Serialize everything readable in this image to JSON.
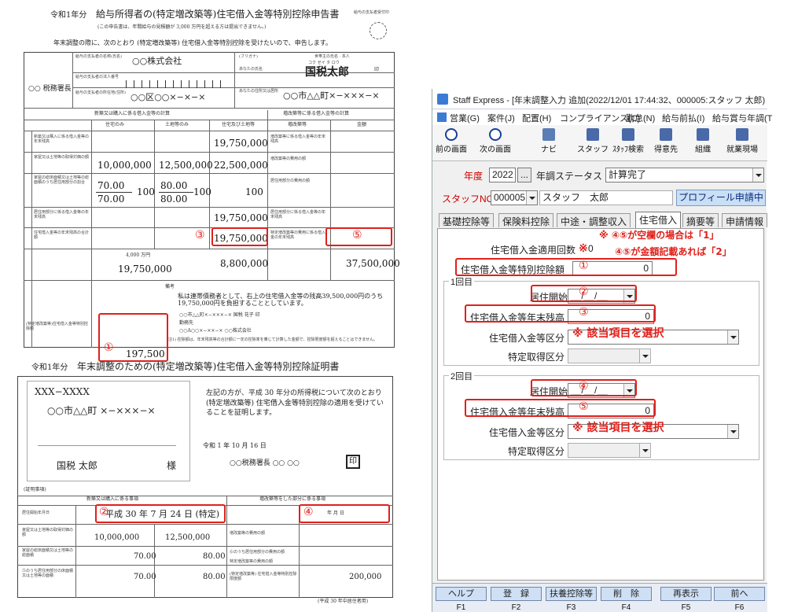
{
  "doc": {
    "form1": {
      "title_year": "令和1年分",
      "title": "給与所得者の(特定増改築等)住宅借入金等特別控除申告書",
      "note_top": "(この申告書は、年間給与の見積額が 3,000 万円を超える方は提出できません。)",
      "submit_line": "年末調整の際に、次のとおり (特定増改築等) 住宅借入金等特別控除を受けたいので、申告します。",
      "corner_text": "給与の支払者受付印",
      "payer_name_label": "給与の支払者の名称(氏名)",
      "payer_name": "○○株式会社",
      "payer_no_label": "給与の支払者の法人番号",
      "payer_addr_label": "給与の支払者の所在地(住所)",
      "payer_addr": "○○区○○×−×−×",
      "office": "○○ 税務署長",
      "furigana_label": "(フリガナ)",
      "furigana": "コク ゼイ タ ロウ",
      "name_label": "あなたの氏名",
      "name": "国税太郎",
      "seal": "印",
      "self_label": "世帯主の氏名 · 本人",
      "addr_label": "あなたの住所又は居所",
      "addr": "○○市△△町×−×××−×",
      "col_house_only": "住宅のみ",
      "col_land_only": "土地等のみ",
      "col_both": "住宅及び土地等",
      "col_renov": "増改築等",
      "col_amount": "金額",
      "section_new": "新築又は購入に係る借入金等の計算",
      "section_renov": "増改築等に係る借入金等の計算",
      "row1": "新築又は購入に係る借入金等の年末残高",
      "row2": "家屋又は土地等の取得対価の額",
      "row3": "家屋の総床面積又は土地等の総面積のうち居住用部分の割合",
      "row4": "居住用部分に係る借入金等の年末残高",
      "row5": "住宅借入金等の年末残高の合計額",
      "row6": "(特定増改築等)住宅借入金等特別控除額",
      "renov_row1": "増改築等に係る借入金等の年末残高",
      "renov_row2": "増改築等の費用の額",
      "renov_row3": "居住用部分の費用の額",
      "renov_row4": "居住用部分に係る借入金等の年末残高",
      "renov_row5": "特定増改築等の費用に係る借入金の年末残高",
      "v_r1": "19,750,000",
      "v_r2a": "10,000,000",
      "v_r2b": "12,500,000",
      "v_r2c": "22,500,000",
      "v_r3a_num": "70.00",
      "v_r3a_den": "70.00",
      "v_r3a_pct": "100",
      "v_r3b_num": "80.00",
      "v_r3b_den": "80.00",
      "v_r3b_pct": "100",
      "v_r3c_pct": "100",
      "v_r4": "19,750,000",
      "v_r5": "19,750,000",
      "v_total_a": "19,750,000",
      "v_total_b": "8,800,000",
      "v_total_c": "37,500,000",
      "v_limit": "4,000 万円",
      "v_credit": "197,500",
      "remarks_label": "備考",
      "remarks": "私は連帯債務者として、右上の住宅借入金等の残高39,500,000円のうち19,750,000円を負担することとしています。",
      "remarks2": "○○市△△町×−×××−×   国税 花子 印",
      "remarks3": "勤務先",
      "remarks4": "○○A○○×−××−×  ○○株式会社",
      "footnote": "(注1) 控除額は、年末残高等の合計額に一定の控除率を乗じて計算した金額で、控除限度額を超えることはできません。",
      "circle1": "①",
      "circle3": "③",
      "circle5": "⑤"
    },
    "form2": {
      "title_year": "令和1年分",
      "title": "年末調整のための(特定増改築等)住宅借入金等特別控除証明書",
      "postal": "XXX−XXXX",
      "addr": "○○市△△町 ×−×××−×",
      "name": "国税 太郎",
      "sama": "様",
      "statement": "左記の方が、平成 30 年分の所得税について次のとおり (特定増改築等) 住宅借入金等特別控除の適用を受けていることを証明します。",
      "date": "令和 1 年 10 月 16 日",
      "office": "○○税務署長   ○○ ○○",
      "seal": "印",
      "cert_label": "(証明事項)",
      "sec_new": "新築又は購入に係る事項",
      "sec_renov": "増改築等をした部分に係る事項",
      "move_in_label": "居住開始年月日",
      "move_in": "平成 30 年 7 月 24 日 (特定)",
      "renov_move_in": "年   月   日",
      "r2_label": "家屋又は土地等の取得対価の額",
      "r2a": "10,000,000",
      "r2b": "12,500,000",
      "r3_label": "家屋の総床面積又は土地等の総面積",
      "r3a": "70.00",
      "r3b": "80.00",
      "r4_label": "⑤のうち居住用部分の床面積又は土地等の面積",
      "r4a": "70.00",
      "r4b": "80.00",
      "renov_r2": "増改築等の費用の額",
      "renov_r3": "⑥のうち居住用部分の費用の額",
      "renov_r4": "特定増改築等の費用の額",
      "renov_r5": "(特定増改築等) 住宅借入金等特別控除限度額",
      "limit": "200,000",
      "footer": "(平成 30 年中居住者用)",
      "circle2": "②",
      "circle4": "④"
    }
  },
  "app": {
    "title": "Staff Express - [年末調整入力 追加(2022/12/01 17:44:32、000005:スタッフ 太郎) 更新(2022,",
    "menu": [
      "営業(G)",
      "案件(J)",
      "配置(H)",
      "コンプライアンス(C)",
      "勤怠(N)",
      "給与前払(I)",
      "給与賞与年調(T"
    ],
    "toolbar": [
      "前の画面",
      "次の画面",
      "ナビ",
      "スタッフ",
      "ｽﾀｯﾌ検索",
      "得意先",
      "組織",
      "就業現場"
    ],
    "year_label": "年度",
    "year_value": "2022",
    "year_btn": "...",
    "status_label": "年調ステータス",
    "status_value": "計算完了",
    "staff_label": "スタッフNO",
    "staff_no": "000005",
    "staff_name": "スタッフ　太郎",
    "profile_btn": "プロフィール申請中",
    "tabs": [
      "基礎控除等",
      "保険料控除",
      "中途・調整収入",
      "住宅借入",
      "摘要等",
      "申請情報"
    ],
    "active_tab": 3,
    "count_label": "住宅借入金適用回数",
    "count_value": "0",
    "count_mark": "※",
    "credit_label": "住宅借入金等特別控除額",
    "credit_value": "0",
    "group1_title": "1回目",
    "group2_title": "2回目",
    "move_in_label": "居住開始日",
    "date_placeholder": "__/__/__",
    "balance_label": "住宅借入金等年末残高",
    "balance_value": "0",
    "loan_type_label": "住宅借入金等区分",
    "special_label": "特定取得区分",
    "fkeys": [
      {
        "label": "ヘルプ",
        "key": "F1"
      },
      {
        "label": "登　録",
        "key": "F2"
      },
      {
        "label": "扶養控除等",
        "key": "F3"
      },
      {
        "label": "削　除",
        "key": "F4"
      },
      {
        "label": "再表示",
        "key": "F5"
      },
      {
        "label": "前へ",
        "key": "F6"
      }
    ]
  },
  "annotations": {
    "note1": "※ ④⑤が空欄の場合は「1」",
    "note2": "④⑤が金額記載あれば「2」",
    "select_note": "※ 該当項目を選択",
    "c1": "①",
    "c2": "②",
    "c3": "③",
    "c4": "④",
    "c5": "⑤"
  },
  "colors": {
    "annotation_red": "#e0201b",
    "fkey_blue": "#cfe0f5",
    "label_red": "#d00000"
  }
}
